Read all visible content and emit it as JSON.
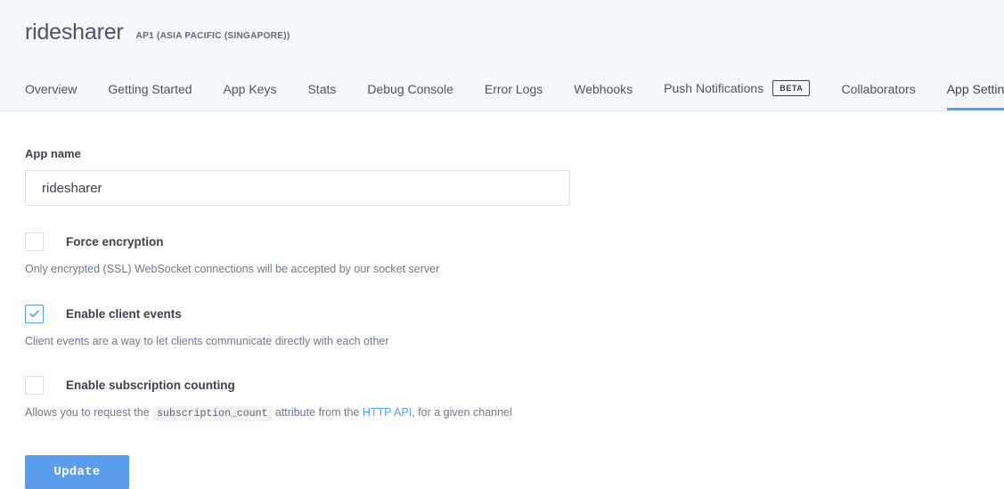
{
  "header": {
    "app_name": "ridesharer",
    "region": "AP1 (ASIA PACIFIC (SINGAPORE))"
  },
  "nav": {
    "items": [
      {
        "label": "Overview",
        "active": false,
        "badge": null
      },
      {
        "label": "Getting Started",
        "active": false,
        "badge": null
      },
      {
        "label": "App Keys",
        "active": false,
        "badge": null
      },
      {
        "label": "Stats",
        "active": false,
        "badge": null
      },
      {
        "label": "Debug Console",
        "active": false,
        "badge": null
      },
      {
        "label": "Error Logs",
        "active": false,
        "badge": null
      },
      {
        "label": "Webhooks",
        "active": false,
        "badge": null
      },
      {
        "label": "Push Notifications",
        "active": false,
        "badge": "BETA"
      },
      {
        "label": "Collaborators",
        "active": false,
        "badge": null
      },
      {
        "label": "App Settings",
        "active": true,
        "badge": null
      }
    ]
  },
  "form": {
    "app_name_label": "App name",
    "app_name_value": "ridesharer",
    "app_name_placeholder": "App name",
    "options": [
      {
        "label": "Force encryption",
        "checked": false,
        "description": "Only encrypted (SSL) WebSocket connections will be accepted by our socket server"
      },
      {
        "label": "Enable client events",
        "checked": true,
        "description": "Client events are a way to let clients communicate directly with each other"
      },
      {
        "label": "Enable subscription counting",
        "checked": false,
        "description_parts": {
          "before_code": "Allows you to request the",
          "code": "subscription_count",
          "after_code": "attribute from the",
          "link": "HTTP API",
          "tail": ", for a given channel"
        }
      }
    ],
    "submit_label": "Update"
  },
  "colors": {
    "accent": "#5a9ded",
    "header_bg": "#f4f7fa",
    "text_dark": "#3a4450",
    "text_muted": "#6b7b8c",
    "border": "#dde3ea"
  },
  "icons": {
    "checkmark": "check-icon"
  }
}
